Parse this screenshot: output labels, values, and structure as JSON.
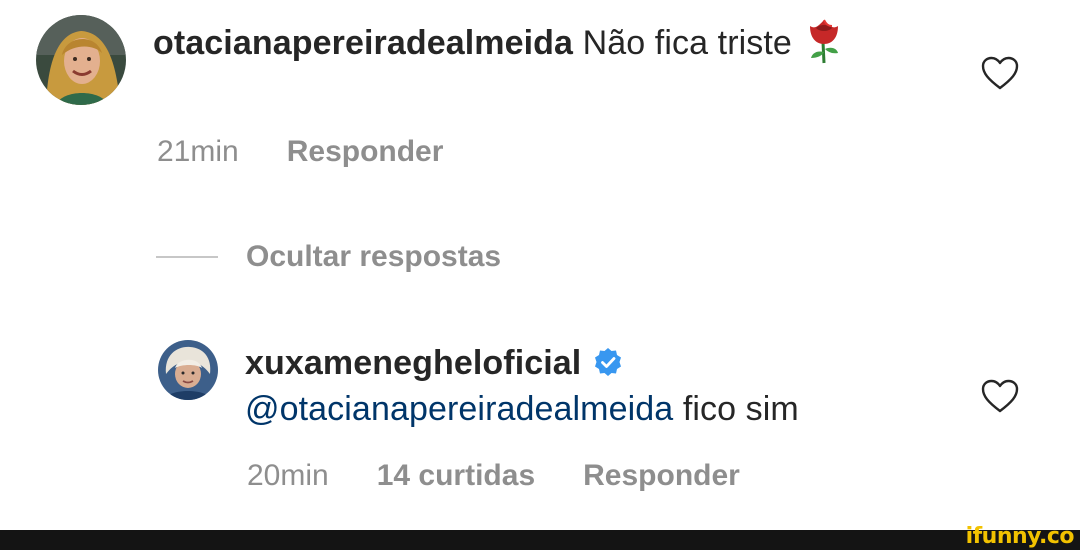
{
  "comments": [
    {
      "username": "otacianapereiradealmeida",
      "text": " Não fica triste",
      "emoji_icon": "rose-icon",
      "time": "21min",
      "reply_label": "Responder",
      "heart_icon": "heart-outline-icon"
    },
    {
      "username": "xuxameneghel​oficial",
      "verified_icon": "verified-badge-icon",
      "mention": "@otacianapereiradealmeida",
      "text": " fico sim",
      "time": "20min",
      "likes": "14 curtidas",
      "reply_label": "Responder",
      "heart_icon": "heart-outline-icon"
    }
  ],
  "replies_toggle": {
    "label": "Ocultar respostas"
  },
  "watermark": "ifunny.co",
  "colors": {
    "text": "#262626",
    "meta": "#8e8e8e",
    "mention": "#003569",
    "verified": "#3897f0",
    "footer": "#141414",
    "watermark": "#f2c200"
  }
}
